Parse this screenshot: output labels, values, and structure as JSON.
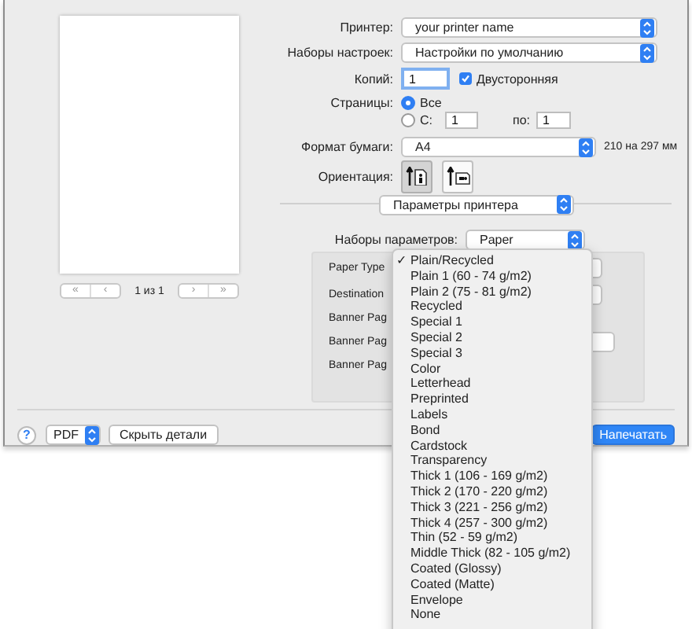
{
  "preview": {
    "nav_back": [
      "«",
      "‹"
    ],
    "nav_forward": [
      "›",
      "»"
    ],
    "page_label": "1 из 1"
  },
  "printer": {
    "label": "Принтер:",
    "value": "your printer name"
  },
  "presets": {
    "label": "Наборы настроек:",
    "value": "Настройки по умолчанию"
  },
  "copies": {
    "label": "Копий:",
    "value": "1"
  },
  "duplex": {
    "label": "Двусторонняя",
    "checked": true
  },
  "pages": {
    "label": "Страницы:",
    "options": [
      {
        "label": "Все",
        "selected": true
      },
      {
        "label": "С:",
        "selected": false
      }
    ],
    "from": "1",
    "to_label": "по:",
    "to": "1"
  },
  "paper_size": {
    "label": "Формат бумаги:",
    "value": "A4",
    "dimensions": "210 на 297 мм"
  },
  "orientation": {
    "label": "Ориентация:",
    "options": [
      {
        "kind": "portrait",
        "selected": true
      },
      {
        "kind": "landscape",
        "selected": false
      }
    ]
  },
  "section": {
    "value": "Параметры принтера"
  },
  "parameter_sets": {
    "label": "Наборы параметров:",
    "value": "Paper"
  },
  "panel_rows": [
    {
      "label": "Paper Type",
      "kind": "select"
    },
    {
      "label": "Destination",
      "kind": "select"
    },
    {
      "label": "Banner Pag"
    },
    {
      "label": "Banner Pag",
      "kind": "select"
    },
    {
      "label": "Banner Pag"
    }
  ],
  "menu": {
    "check_mark": "✓",
    "items": [
      {
        "label": "Plain/Recycled",
        "selected": true
      },
      {
        "label": "Plain 1 (60 - 74 g/m2)",
        "selected": false
      },
      {
        "label": "Plain 2 (75 - 81 g/m2)",
        "selected": false
      },
      {
        "label": "Recycled",
        "selected": false
      },
      {
        "label": "Special 1",
        "selected": false
      },
      {
        "label": "Special 2",
        "selected": false
      },
      {
        "label": "Special 3",
        "selected": false
      },
      {
        "label": "Color",
        "selected": false
      },
      {
        "label": "Letterhead",
        "selected": false
      },
      {
        "label": "Preprinted",
        "selected": false
      },
      {
        "label": "Labels",
        "selected": false
      },
      {
        "label": "Bond",
        "selected": false
      },
      {
        "label": "Cardstock",
        "selected": false
      },
      {
        "label": "Transparency",
        "selected": false
      },
      {
        "label": "Thick 1 (106 - 169 g/m2)",
        "selected": false
      },
      {
        "label": "Thick 2 (170 - 220 g/m2)",
        "selected": false
      },
      {
        "label": "Thick 3 (221 - 256 g/m2)",
        "selected": false
      },
      {
        "label": "Thick 4 (257 - 300 g/m2)",
        "selected": false
      },
      {
        "label": "Thin (52 - 59 g/m2)",
        "selected": false
      },
      {
        "label": "Middle Thick (82 - 105 g/m2)",
        "selected": false
      },
      {
        "label": "Coated (Glossy)",
        "selected": false
      },
      {
        "label": "Coated (Matte)",
        "selected": false
      },
      {
        "label": "Envelope",
        "selected": false
      },
      {
        "label": "None",
        "selected": false
      }
    ]
  },
  "bottom": {
    "help": "?",
    "pdf": "PDF",
    "hide_details": "Скрыть детали",
    "print": "Напечатать"
  }
}
